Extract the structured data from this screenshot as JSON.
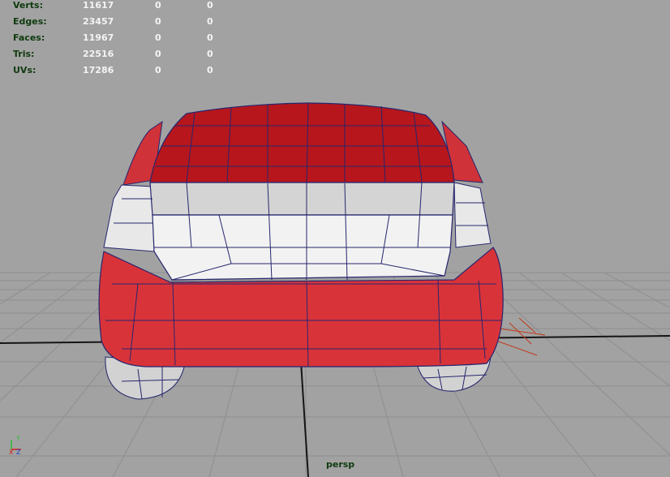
{
  "viewport": {
    "camera": "persp",
    "stats": [
      {
        "label": "Verts:",
        "v1": "11617",
        "v2": "0",
        "v3": "0"
      },
      {
        "label": "Edges:",
        "v1": "23457",
        "v2": "0",
        "v3": "0"
      },
      {
        "label": "Faces:",
        "v1": "11967",
        "v2": "0",
        "v3": "0"
      },
      {
        "label": "Tris:",
        "v1": "22516",
        "v2": "0",
        "v3": "0"
      },
      {
        "label": "UVs:",
        "v1": "17286",
        "v2": "0",
        "v3": "0"
      }
    ],
    "axis": {
      "y": "Y",
      "x": "X",
      "z": "Z"
    }
  },
  "colors": {
    "background": "#a2a2a2",
    "grid": "#8b8b8b",
    "car_body": "#d9333a",
    "car_window": "#b7161c",
    "car_lights": "#ececec",
    "wireframe": "#2a2a7a"
  }
}
